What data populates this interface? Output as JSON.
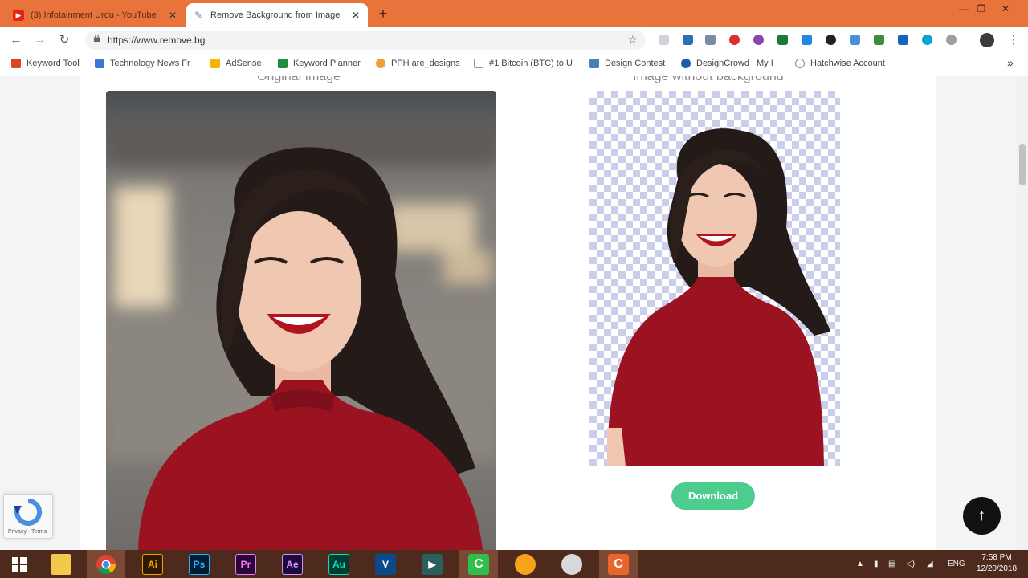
{
  "browser": {
    "tabs": [
      {
        "title": "(3) Infotainment Urdu - YouTube",
        "state": "inactive",
        "favicon": "youtube-icon",
        "favicon_color": "#e62117"
      },
      {
        "title": "Remove Background from Image",
        "state": "active",
        "favicon": "remove-bg-icon",
        "favicon_color": "#6e7bd9"
      }
    ],
    "new_tab_label": "+",
    "window_controls": {
      "minimize": "—",
      "restore": "❐",
      "close": "✕"
    },
    "nav": {
      "back": "←",
      "forward": "→",
      "reload": "↻"
    },
    "url": "https://www.remove.bg",
    "bookmarks": [
      {
        "label": "Keyword Tool",
        "icon_color": "#d9452b"
      },
      {
        "label": "Technology News Fr",
        "icon_color": "#3b78d8"
      },
      {
        "label": "AdSense",
        "icon_color": "#f4b400"
      },
      {
        "label": "Keyword Planner",
        "icon_color": "#1e8e3e"
      },
      {
        "label": "PPH are_designs",
        "icon_color": "#f39c3d"
      },
      {
        "label": "#1 Bitcoin (BTC) to U",
        "icon_color": "#999999"
      },
      {
        "label": "Design Contest",
        "icon_color": "#4a7fb5"
      },
      {
        "label": "DesignCrowd | My I",
        "icon_color": "#1b5ea8"
      },
      {
        "label": "Hatchwise Account",
        "icon_color": "#888888"
      }
    ],
    "bookmarks_more": "»"
  },
  "page": {
    "original_caption": "Original Image",
    "nobg_caption": "Image without background",
    "download_label": "Download",
    "recaptcha_label": "Privacy - Terms",
    "scroll_top_label": "↑"
  },
  "taskbar": {
    "apps": [
      {
        "name": "file-explorer",
        "label": "",
        "bg": "#f2c94c",
        "fg": "#6b4a00"
      },
      {
        "name": "chrome",
        "label": "",
        "bg": "#ffffff",
        "fg": "#000"
      },
      {
        "name": "illustrator",
        "label": "Ai",
        "bg": "#2d1a05",
        "fg": "#ff9a00"
      },
      {
        "name": "photoshop",
        "label": "Ps",
        "bg": "#001d34",
        "fg": "#31a8ff"
      },
      {
        "name": "premiere",
        "label": "Pr",
        "bg": "#2a0634",
        "fg": "#e77cff"
      },
      {
        "name": "after-effects",
        "label": "Ae",
        "bg": "#1e0a3c",
        "fg": "#d291ff"
      },
      {
        "name": "audition",
        "label": "Au",
        "bg": "#003c33",
        "fg": "#00e4bb"
      },
      {
        "name": "vegas",
        "label": "V",
        "bg": "#0a4a8a",
        "fg": "#ffffff"
      },
      {
        "name": "tool-app",
        "label": "▶",
        "bg": "#2c5d5f",
        "fg": "#ffffff"
      },
      {
        "name": "camtasia",
        "label": "C",
        "bg": "#2fbf4a",
        "fg": "#ffffff"
      },
      {
        "name": "headphones-app",
        "label": "",
        "bg": "#f6a21a",
        "fg": "#4a1f8a"
      },
      {
        "name": "misc-app",
        "label": "",
        "bg": "#d9d9d9",
        "fg": "#c0392b"
      },
      {
        "name": "camtasia-recorder",
        "label": "C",
        "bg": "#e8652b",
        "fg": "#ffffff"
      }
    ],
    "tray_lang": "ENG",
    "time": "7:58 PM",
    "date": "12/20/2018"
  },
  "colors": {
    "tabbar": "#e8733b",
    "taskbar": "#4e2a1d",
    "download_button": "#4ccd8d",
    "checker": "#c9cfeb"
  }
}
